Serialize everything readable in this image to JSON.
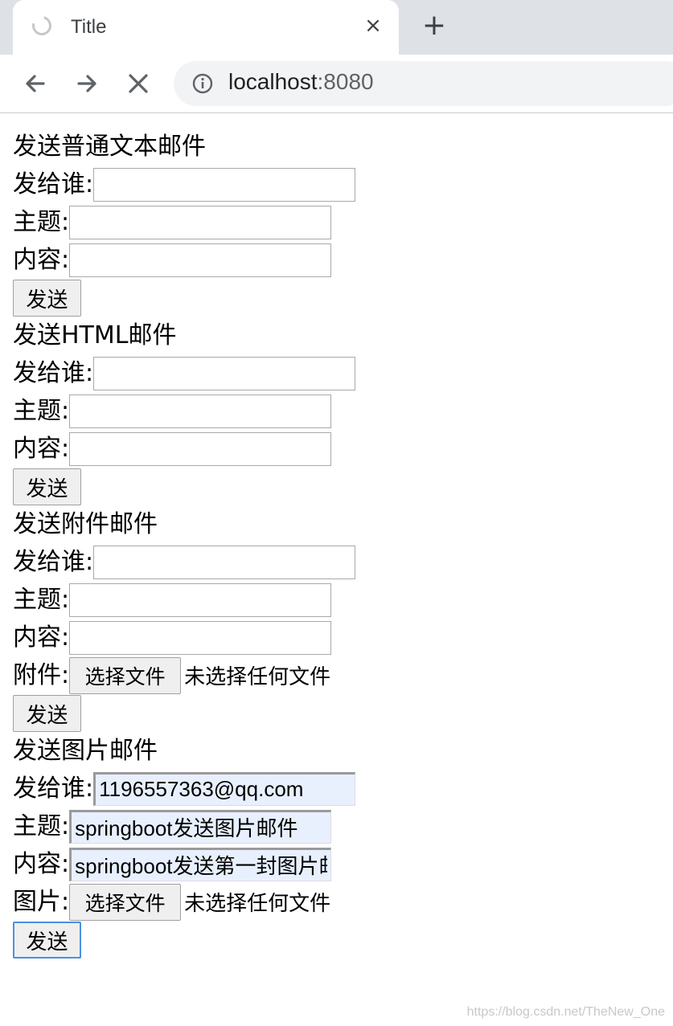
{
  "browser": {
    "tab_title": "Title",
    "tab_close_icon": "×",
    "new_tab_icon": "+",
    "url_host": "localhost",
    "url_port": ":8080"
  },
  "forms": {
    "text": {
      "heading": "发送普通文本邮件",
      "to_label": "发给谁:",
      "subject_label": "主题:",
      "content_label": "内容:",
      "to_value": "",
      "subject_value": "",
      "content_value": "",
      "send_label": "发送"
    },
    "html": {
      "heading": "发送HTML邮件",
      "to_label": "发给谁:",
      "subject_label": "主题:",
      "content_label": "内容:",
      "to_value": "",
      "subject_value": "",
      "content_value": "",
      "send_label": "发送"
    },
    "attachment": {
      "heading": "发送附件邮件",
      "to_label": "发给谁:",
      "subject_label": "主题:",
      "content_label": "内容:",
      "file_label": "附件:",
      "to_value": "",
      "subject_value": "",
      "content_value": "",
      "choose_file_label": "选择文件",
      "file_status": "未选择任何文件",
      "send_label": "发送"
    },
    "image": {
      "heading": "发送图片邮件",
      "to_label": "发给谁:",
      "subject_label": "主题:",
      "content_label": "内容:",
      "file_label": "图片:",
      "to_value": "1196557363@qq.com",
      "subject_value": "springboot发送图片邮件",
      "content_value": "springboot发送第一封图片邮件",
      "choose_file_label": "选择文件",
      "file_status": "未选择任何文件",
      "send_label": "发送"
    }
  },
  "watermark": "https://blog.csdn.net/TheNew_One",
  "colors": {
    "autofill_bg": "#e8f0fe",
    "focus_ring": "#4a90e2",
    "tabstrip_bg": "#dee1e6"
  }
}
